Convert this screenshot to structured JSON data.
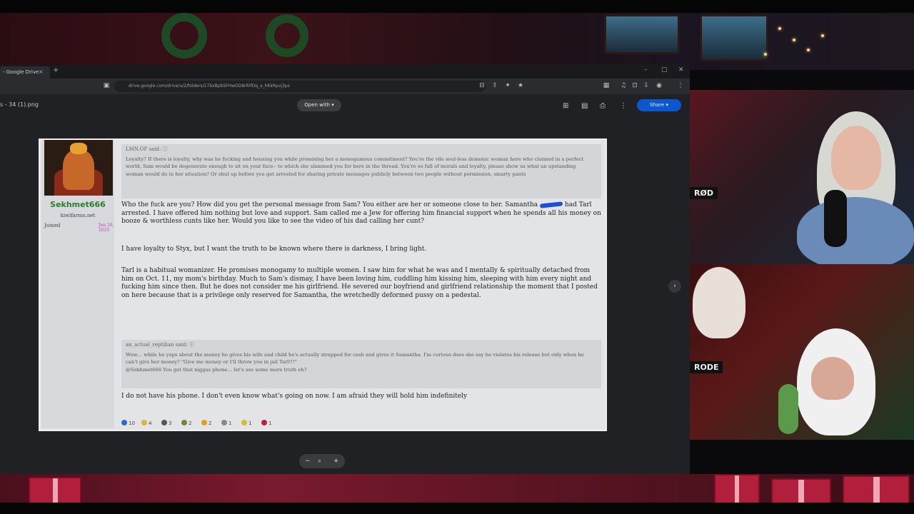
{
  "browser": {
    "tab_title": "- Google Drive",
    "tab_close": "×",
    "new_tab": "+",
    "url": "drive.google.com/drive/u/2/folders/17bxBpbSFHwOD8rRifDq_a_hKkRpvj3ps",
    "window_controls": [
      "–",
      "▢",
      "✕"
    ]
  },
  "viewer": {
    "filename": "s - 34 (1).png",
    "open_with": "Open with",
    "share": "Share",
    "next": "›",
    "zoom": {
      "out": "−",
      "icon": "⌕",
      "in": "+"
    }
  },
  "post": {
    "user": {
      "name": "Sekhmet666",
      "title": "kiwifarms.net",
      "joined_label": "Joined",
      "joined_date": "Jun 26, 2025"
    },
    "quote1": {
      "author": "LMN.OP said: ⓘ",
      "body": "Loyalty? If there is loyalty, why was he fucking and housing you while promising her a monogamous commitment? You're the vile soul-less demonic woman here who claimed in a perfect world, Sam would be degenerate enough to sit on your face-- to which she slammed you for here in the thread. You're so full of morals and loyalty, please show us what an upstanding woman would do in her situation? Or shut up before you get arrested for sharing private messages publicly between two people without permission, smarty pants"
    },
    "para1_a": "Who the fuck are you? How did you get the personal message from Sam? You either are her or someone close to her. Samantha",
    "para1_b": "had Tarl arrested. I have offered him nothing but love and support. Sam called me a Jew for offering him financial support when he spends all his money on booze & worthless cunts like her. Would you like to see the video of his dad calling her cunt?",
    "para2": "I have loyalty to Styx, but I want the truth to be known where there is darkness, I bring light.",
    "para3": "Tarl is a habitual womanizer. He promises monogamy to multiple women. I saw him for what he was and I mentally & spiritually detached from him on Oct. 11, my mom's birthday. Much to Sam's dismay, I have been loving him, cuddling him kissing him, sleeping with him every night and fucking him since then. But he does not consider me his girlfriend. He severed our boyfriend and girlfriend relationship the moment that I posted on here because that is a privilege only reserved for Samantha, the wretchedly deformed pussy on a pedestal.",
    "quote2": {
      "author": "an_actual_reptilian said: ⓘ",
      "body": "Wow… while he yaps about the money he gives his wife and child he's actually strapped for cash and gives it Samantha. I'm curious does she say he violates his release but only when he can't give her money? \"Give me money or I'll throw you in jail Tarl!!!\"",
      "body2": "@Sekhmet666 You got that niggas phone… let's see some more truth eh?"
    },
    "para4": "I do not have his phone. I don't even know what's going on now. I am afraid they will hold him indefinitely",
    "reactions": [
      {
        "count": "10",
        "color": "#2a6cd6"
      },
      {
        "count": "4",
        "color": "#e0b040"
      },
      {
        "count": "3",
        "color": "#555555"
      },
      {
        "count": "2",
        "color": "#6a8a3a"
      },
      {
        "count": "2",
        "color": "#e0a020"
      },
      {
        "count": "1",
        "color": "#888888"
      },
      {
        "count": "1",
        "color": "#d0c030"
      },
      {
        "count": "1",
        "color": "#c02040"
      }
    ]
  },
  "stream": {
    "mic_brand_1": "RØD",
    "mic_brand_2": "RODE"
  }
}
